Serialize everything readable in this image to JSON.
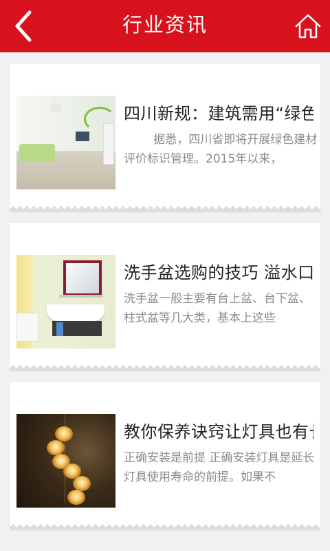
{
  "header": {
    "title": "行业资讯",
    "back_icon": "chevron-left-icon",
    "home_icon": "home-icon",
    "background_color": "#d7121c"
  },
  "articles": [
    {
      "title": "四川新规：建筑需用“绿色",
      "summary": "        据悉，四川省即将开展绿色建材评价标识管理。2015年以来，",
      "thumbnail": "living-room-photo"
    },
    {
      "title": "洗手盆选购的技巧 溢水口",
      "summary": "洗手盆一般主要有台上盆、台下盆、柱式盆等几大类，基本上这些",
      "thumbnail": "washbasin-photo"
    },
    {
      "title": "教你保养诀窍让灯具也有长",
      "summary": "正确安装是前提 正确安装灯具是延长灯具使用寿命的前提。如果不",
      "thumbnail": "pendant-lights-photo"
    }
  ]
}
